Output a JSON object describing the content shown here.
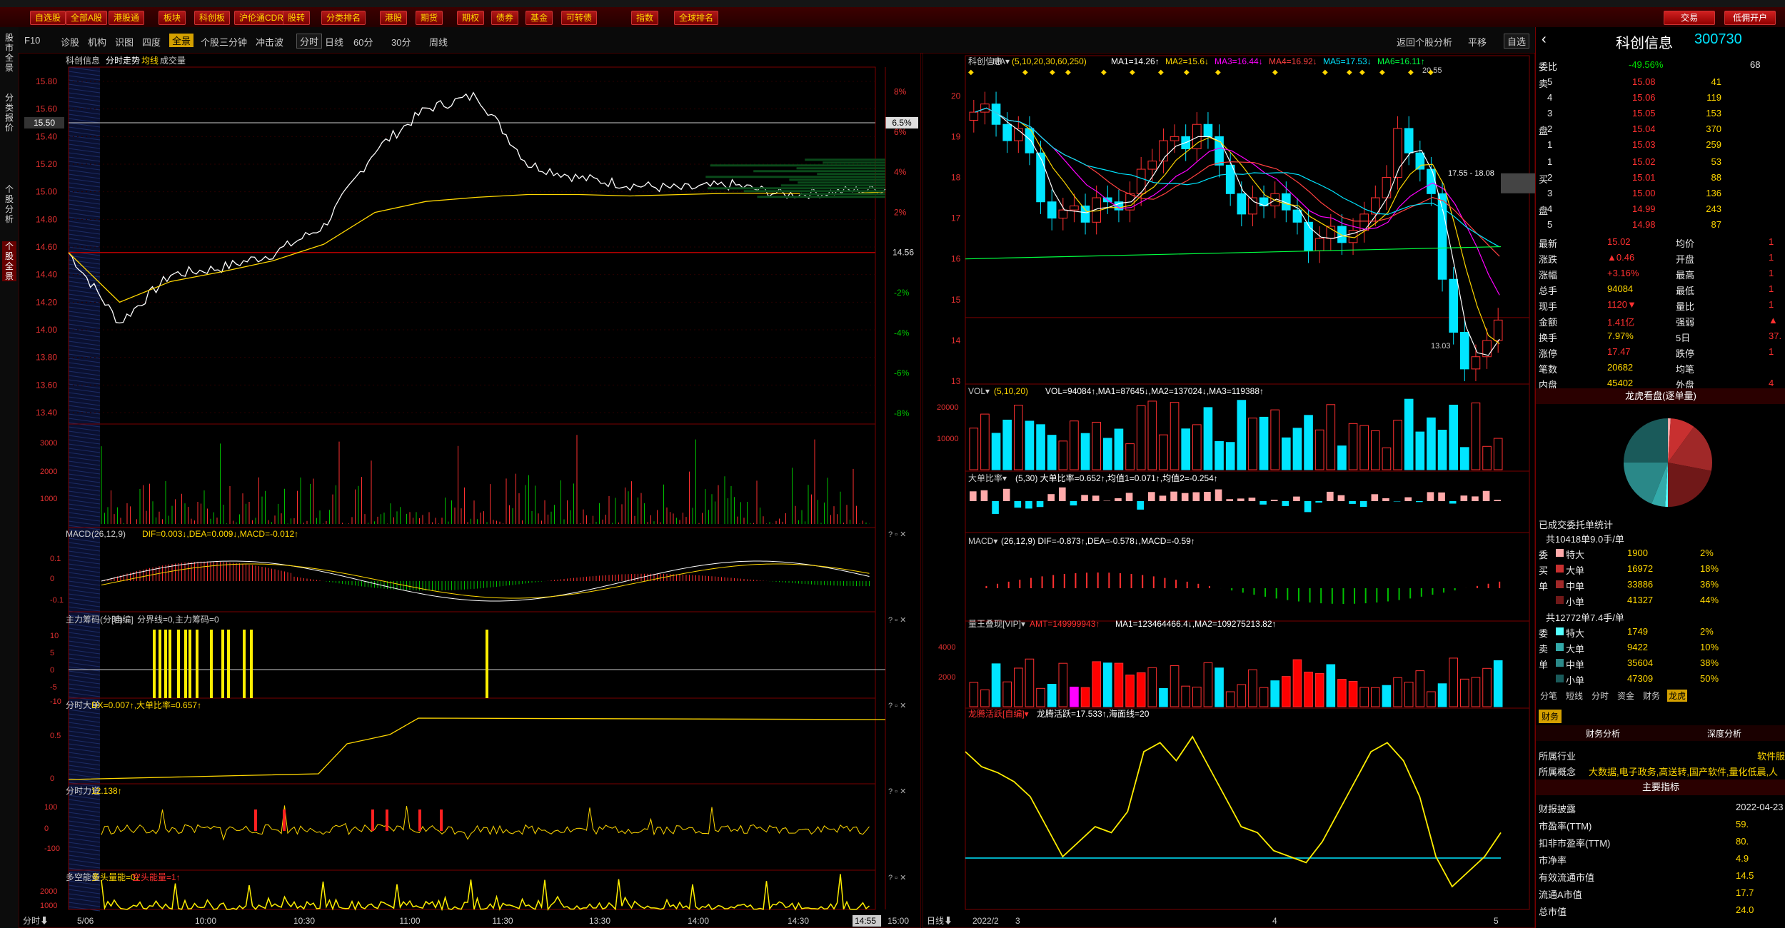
{
  "toolbar": {
    "items": [
      "自选股",
      "全部A股",
      "港股通",
      "板块",
      "科创板",
      "沪伦通CDR",
      "股转",
      "分类排名",
      "港股",
      "期货",
      "期权",
      "债券",
      "基金",
      "可转债",
      "指数",
      "全球排名"
    ],
    "right": [
      "交易",
      "低佣开户"
    ]
  },
  "sidebar": {
    "tabs": [
      "股市全景",
      "分类报价",
      "个股分析",
      "个股全景"
    ]
  },
  "subbar": {
    "left": [
      "F10",
      "诊股",
      "机构",
      "识图",
      "四度"
    ],
    "active": "全景",
    "mid": [
      "个股三分钟",
      "冲击波"
    ],
    "periods": [
      "分时",
      "日线",
      "60分",
      "30分",
      "周线"
    ],
    "right": [
      "返回个股分析",
      "平移",
      "自选"
    ]
  },
  "intraday": {
    "header": {
      "name": "科创信息",
      "title": "分时走势",
      "avg": "均线",
      "vol": "成交量"
    },
    "price_ticks": [
      "15.80",
      "15.60",
      "15.40",
      "15.20",
      "15.00",
      "14.80",
      "14.60",
      "14.40",
      "14.20",
      "14.00",
      "13.80",
      "13.60",
      "13.40"
    ],
    "pct_ticks": [
      "8%",
      "6%",
      "4%",
      "2%",
      "",
      "-2%",
      "-4%",
      "-6%",
      "-8%"
    ],
    "cursor_price": "15.50",
    "cursor_pct": "6.5%",
    "prev_close": "14.56",
    "vol_ticks": [
      "3000",
      "2000",
      "1000"
    ],
    "macd_title": "MACD",
    "macd_params": "(26,12,9)",
    "macd_vals": "DIF=0.003↓,DEA=0.009↓,MACD=-0.012↑",
    "macd_ticks": [
      "0.1",
      "0",
      "-0.1"
    ],
    "zl_title": "主力筹码(分时)",
    "zl_sub": "[自编]",
    "zl_vals": "分界线=0,主力筹码=0",
    "zl_ticks": [
      "10",
      "5",
      "0",
      "-5",
      "-10"
    ],
    "dd_title": "分时大单",
    "dd_vals": "DX=0.007↑,大单比率=0.657↑",
    "dd_ticks": [
      "0.5",
      "0"
    ],
    "ld_title": "分时力道",
    "ld_vals": "12.138↑",
    "ld_ticks": [
      "100",
      "0",
      "-100"
    ],
    "dk_title": "多空能量",
    "dk_v1": "多头量能=0↓",
    "dk_v2": "空头能量=1↑",
    "dk_ticks": [
      "2000",
      "1000"
    ],
    "time_labels": [
      "5/06",
      "10:00",
      "10:30",
      "11:00",
      "11:30",
      "13:30",
      "14:00",
      "14:30",
      "14:55",
      "15:00"
    ],
    "bottom_label": "分时"
  },
  "kline": {
    "header": {
      "name": "科创信息",
      "ma_label": "MA",
      "params": "(5,10,20,30,60,250)",
      "ma1": "MA1=14.26↑",
      "ma2": "MA2=15.6↓",
      "ma3": "MA3=16.44↓",
      "ma4": "MA4=16.92↓",
      "ma5": "MA5=17.53↓",
      "ma6": "MA6=16.11↑"
    },
    "price_ticks": [
      "20",
      "19",
      "18",
      "17",
      "16",
      "15",
      "14",
      "13"
    ],
    "high_label": "20.55",
    "low_label": "13.03",
    "box_label": "17.55 - 18.08",
    "vol_title": "VOL",
    "vol_params": "(5,10,20)",
    "vol_vals": "VOL=94084↑,MA1=87645↓,MA2=137024↓,MA3=119388↑",
    "vol_ticks": [
      "20000",
      "10000"
    ],
    "dbl_title": "大单比率",
    "dbl_vals": "(5,30) 大单比率=0.652↑,均值1=0.071↑,均值2=-0.254↑",
    "macd_title": "MACD",
    "macd_vals": "(26,12,9) DIF=-0.873↑,DEA=-0.578↓,MACD=-0.59↑",
    "lw_title": "量王叠现[VIP]",
    "lw_amt": "AMT=149999943↑",
    "lw_vals": "MA1=123464466.4↓,MA2=109275213.82↑",
    "lw_ticks": [
      "4000",
      "2000"
    ],
    "lt_title": "龙腾活跃[自编]",
    "lt_vals": "龙腾活跃=17.533↑,海面线=20",
    "date_labels": [
      "2022/2",
      "3",
      "4",
      "5"
    ],
    "bottom_label": "日线"
  },
  "chart_data": [
    {
      "type": "line",
      "title": "分时走势",
      "series": [
        {
          "name": "均线",
          "values": [
            14.56,
            14.2,
            14.35,
            14.42,
            14.5,
            14.62,
            14.85,
            14.93,
            14.96,
            14.98,
            14.98,
            14.97,
            14.98,
            14.99,
            14.99,
            14.98,
            15.0
          ]
        }
      ],
      "price_values": [
        14.56,
        14.05,
        14.4,
        14.45,
        14.55,
        14.75,
        15.3,
        15.6,
        15.7,
        15.2,
        15.1,
        15.05,
        15.02,
        15.05,
        14.98,
        15.0,
        15.02
      ],
      "ylim": [
        13.4,
        15.8
      ]
    },
    {
      "type": "bar",
      "title": "K线",
      "categories": [
        "2022/2",
        "3",
        "4",
        "5"
      ],
      "ylim": [
        13,
        20.6
      ]
    }
  ],
  "right": {
    "title": "科创信息",
    "code": "300730",
    "weibi": {
      "label": "委比",
      "pct": "-49.56%",
      "num": "68"
    },
    "sell": [
      {
        "l": "卖",
        "n": "5",
        "p": "15.08",
        "v": "41"
      },
      {
        "l": "",
        "n": "4",
        "p": "15.06",
        "v": "119"
      },
      {
        "l": "",
        "n": "3",
        "p": "15.05",
        "v": "153"
      },
      {
        "l": "盘",
        "n": "2",
        "p": "15.04",
        "v": "370"
      },
      {
        "l": "",
        "n": "1",
        "p": "15.03",
        "v": "259"
      }
    ],
    "buy": [
      {
        "l": "",
        "n": "1",
        "p": "15.02",
        "v": "53"
      },
      {
        "l": "买",
        "n": "2",
        "p": "15.01",
        "v": "88"
      },
      {
        "l": "",
        "n": "3",
        "p": "15.00",
        "v": "136"
      },
      {
        "l": "盘",
        "n": "4",
        "p": "14.99",
        "v": "243"
      },
      {
        "l": "",
        "n": "5",
        "p": "14.98",
        "v": "87"
      }
    ],
    "stats": [
      [
        "最新",
        "15.02",
        "均价",
        "1"
      ],
      [
        "涨跌",
        "▲0.46",
        "开盘",
        "1"
      ],
      [
        "涨幅",
        "+3.16%",
        "最高",
        "1"
      ],
      [
        "总手",
        "94084",
        "最低",
        "1"
      ],
      [
        "现手",
        "1120▼",
        "量比",
        "1"
      ],
      [
        "金额",
        "1.41亿",
        "强弱",
        "▲"
      ],
      [
        "换手",
        "7.97%",
        "5日",
        "37."
      ],
      [
        "涨停",
        "17.47",
        "跌停",
        "1"
      ],
      [
        "笔数",
        "20682",
        "均笔",
        ""
      ],
      [
        "内盘",
        "45402",
        "外盘",
        "4"
      ]
    ],
    "pie_title": "龙虎看盘(逐单量)",
    "entrust_title": "已成交委托单统计",
    "buy_total": "共10418单9.0手/单",
    "buy_rows": [
      [
        "委",
        "特大",
        "1900",
        "2%"
      ],
      [
        "买",
        "大单",
        "16972",
        "18%"
      ],
      [
        "单",
        "中单",
        "33886",
        "36%"
      ],
      [
        "",
        "小单",
        "41327",
        "44%"
      ]
    ],
    "sell_total": "共12772单7.4手/单",
    "sell_rows": [
      [
        "委",
        "特大",
        "1749",
        "2%"
      ],
      [
        "卖",
        "大单",
        "9422",
        "10%"
      ],
      [
        "单",
        "中单",
        "35604",
        "38%"
      ],
      [
        "",
        "小单",
        "47309",
        "50%"
      ]
    ],
    "tabs": [
      "分笔",
      "短线",
      "分时",
      "资金",
      "财务",
      "龙虎"
    ],
    "fin_tab": "财务",
    "fin_sub": [
      "财务分析",
      "深度分析"
    ],
    "industry_label": "所属行业",
    "industry": "软件服",
    "concept_label": "所属概念",
    "concept": "大数据,电子政务,高送转,国产软件,量化低晨,人",
    "main_idx": "主要指标",
    "fin": [
      [
        "财报披露",
        "2022-04-23"
      ],
      [
        "市盈率(TTM)",
        "59."
      ],
      [
        "扣非市盈率(TTM)",
        "80."
      ],
      [
        "市净率",
        "4.9"
      ],
      [
        "有效流通市值",
        "14.5"
      ],
      [
        "流通A市值",
        "17.7"
      ],
      [
        "总市值",
        "24.0"
      ]
    ]
  }
}
